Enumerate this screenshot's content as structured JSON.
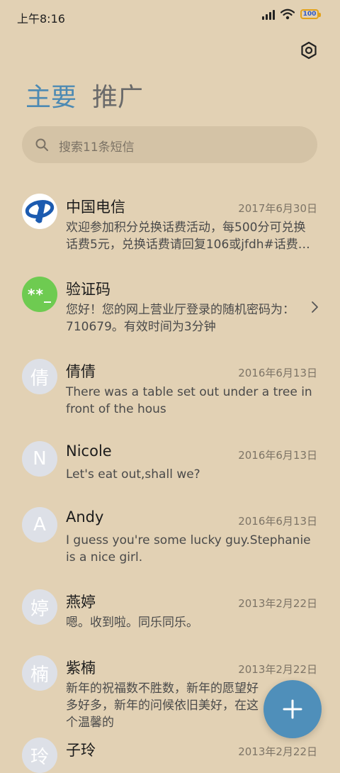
{
  "status": {
    "time": "上午8:16",
    "battery": "100"
  },
  "tabs": [
    {
      "label": "主要"
    },
    {
      "label": "推广"
    }
  ],
  "search": {
    "placeholder": "搜索11条短信"
  },
  "conversations": [
    {
      "name": "中国电信",
      "date": "2017年6月30日",
      "preview": "欢迎参加积分兑换话费活动，每500分可兑换话费5元，兑换话费请回复106或jfdh#话费…",
      "avatar": "telecom-logo"
    },
    {
      "name": "验证码",
      "date": "",
      "preview": "您好！您的网上营业厅登录的随机密码为：710679。有效时间为3分钟",
      "avatar_text": "**_"
    },
    {
      "name": "倩倩",
      "date": "2016年6月13日",
      "preview": "There was a table set out under a tree in front of the hous",
      "avatar_text": "倩"
    },
    {
      "name": "Nicole",
      "date": "2016年6月13日",
      "preview": "Let's eat out,shall we?",
      "avatar_text": "N"
    },
    {
      "name": "Andy",
      "date": "2016年6月13日",
      "preview": "I guess you're some lucky guy.Stephanie is a nice girl.",
      "avatar_text": "A"
    },
    {
      "name": "燕婷",
      "date": "2013年2月22日",
      "preview": "嗯。收到啦。同乐同乐。",
      "avatar_text": "婷"
    },
    {
      "name": "紫楠",
      "date": "2013年2月22日",
      "preview": "新年的祝福数不胜数，新年的愿望好多好多，新年的问候依旧美好，在这个温馨的",
      "avatar_text": "楠"
    },
    {
      "name": "子玲",
      "date": "2013年2月22日",
      "preview": "",
      "avatar_text": "玲"
    }
  ],
  "colors": {
    "background": "#e2d1b4",
    "accent": "#4d8ab3",
    "fab": "#4f8fba",
    "verify_avatar": "#6ecb51"
  },
  "icons": {
    "settings": "settings-icon",
    "search": "search-icon",
    "compose": "plus-icon",
    "chevron": "chevron-right-icon"
  }
}
